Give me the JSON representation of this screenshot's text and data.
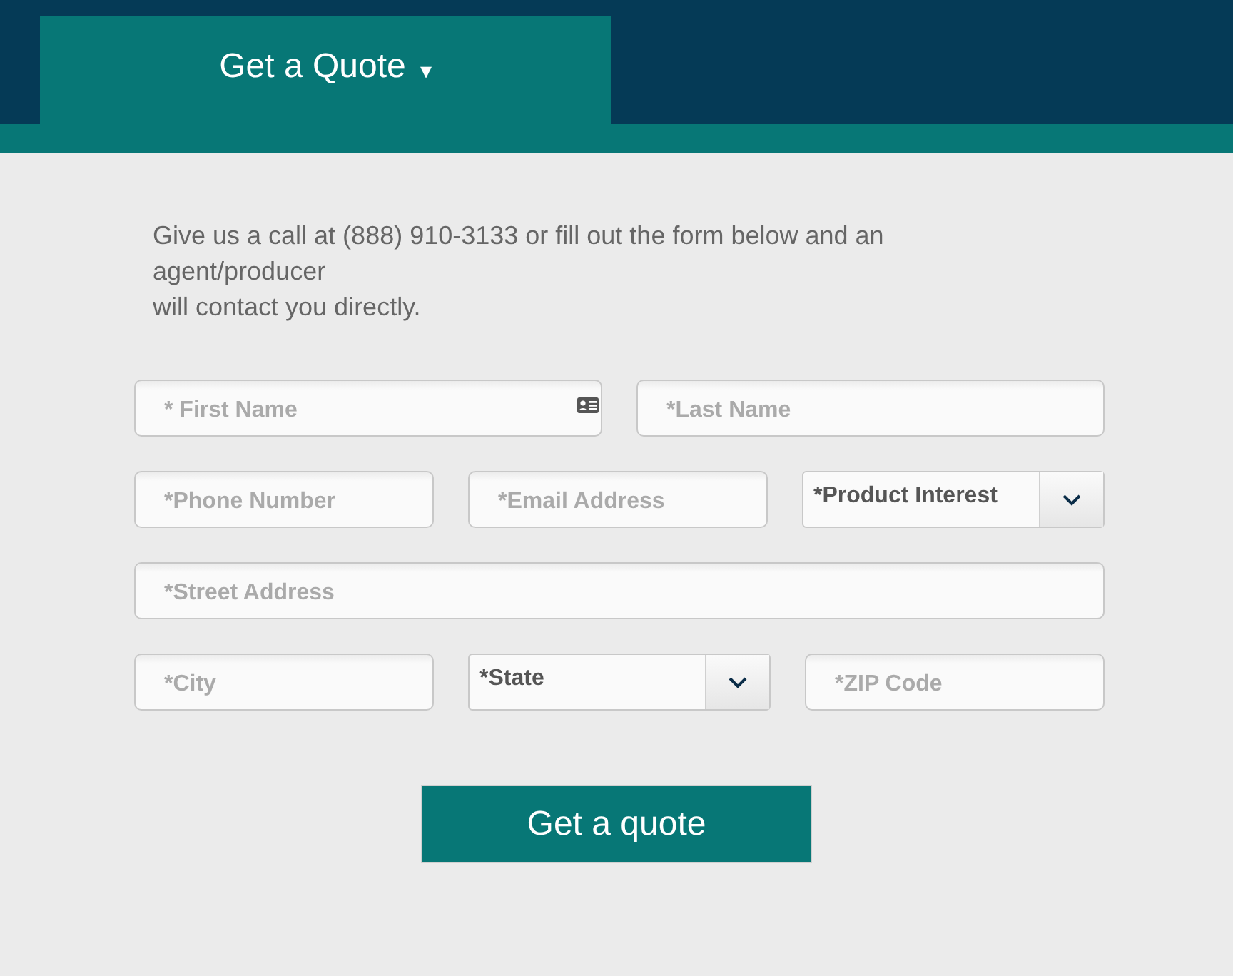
{
  "header": {
    "tab": {
      "label": "Get a Quote",
      "caret": "▾"
    }
  },
  "intro": [
    "Give us a call at (888) 910-3133 or fill out the form below and an agent/producer",
    "will contact you directly."
  ],
  "form": {
    "rows": [
      [
        {
          "kind": "text",
          "placeholder": "* First Name",
          "contact_icon": true
        },
        {
          "kind": "text",
          "placeholder": "*Last Name"
        }
      ],
      [
        {
          "kind": "text",
          "placeholder": "*Phone Number"
        },
        {
          "kind": "text",
          "placeholder": "*Email Address"
        },
        {
          "kind": "select",
          "value": "*Product Interest"
        }
      ],
      [
        {
          "kind": "text",
          "placeholder": "*Street Address"
        }
      ],
      [
        {
          "kind": "text",
          "placeholder": "*City"
        },
        {
          "kind": "select",
          "value": "*State"
        },
        {
          "kind": "text",
          "placeholder": "*ZIP Code"
        }
      ]
    ],
    "submit": "Get a quote"
  }
}
